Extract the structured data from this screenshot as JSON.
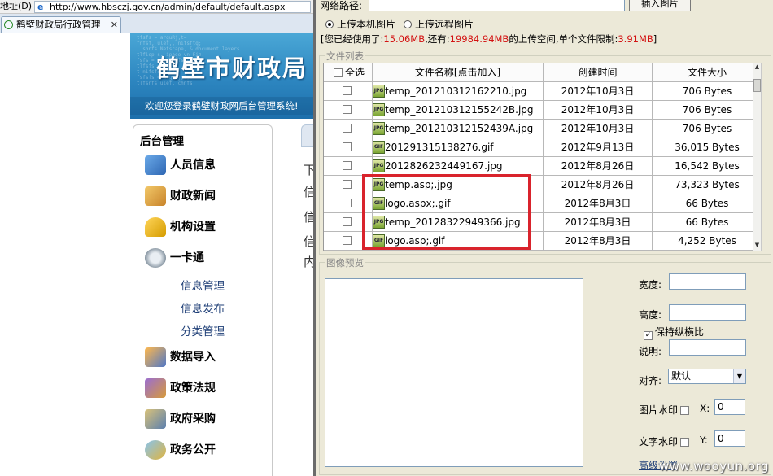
{
  "browser": {
    "address_label": "地址(D)",
    "url": "http://www.hbsczj.gov.cn/admin/default/default.aspx",
    "tab_title": "鹤壁财政局行政管理"
  },
  "banner": {
    "title": "鹤壁市财政局",
    "welcome": "欢迎您登录鹤壁财政网后台管理系统!"
  },
  "sidebar": {
    "title": "后台管理",
    "items": [
      {
        "label": "人员信息",
        "icon": "person-icon"
      },
      {
        "label": "财政新闻",
        "icon": "news-scroll-icon"
      },
      {
        "label": "机构设置",
        "icon": "lock-icon"
      },
      {
        "label": "一卡通",
        "icon": "help-headset-icon"
      },
      {
        "label": "数据导入",
        "icon": "import-icon"
      },
      {
        "label": "政策法规",
        "icon": "law-book-icon"
      },
      {
        "label": "政府采购",
        "icon": "purchase-icon"
      },
      {
        "label": "政务公开",
        "icon": "public-affairs-icon"
      }
    ],
    "subitems": [
      "信息管理",
      "信息发布",
      "分类管理"
    ]
  },
  "content": {
    "chars": [
      "下",
      "信",
      "信",
      "信",
      "内"
    ]
  },
  "dialog": {
    "net_path_label": "网络路径:",
    "insert_button": "插入图片",
    "radio_local": "上传本机图片",
    "radio_remote": "上传远程图片",
    "usage": {
      "prefix": "[您已经使用了:",
      "used": "15.06MB",
      "mid": ",还有:",
      "remaining": "19984.94MB",
      "mid2": "的上传空间,单个文件限制:",
      "limit": "3.91MB",
      "suffix": "]"
    },
    "file_list_legend": "文件列表",
    "table": {
      "headers": [
        "全选",
        "文件名称[点击加入]",
        "创建时间",
        "文件大小"
      ],
      "rows": [
        {
          "name": "temp_201210312162210.jpg",
          "date": "2012年10月3日",
          "size": "706 Bytes",
          "icon": "JPG"
        },
        {
          "name": "temp_201210312155242B.jpg",
          "date": "2012年10月3日",
          "size": "706 Bytes",
          "icon": "JPG"
        },
        {
          "name": "temp_201210312152439A.jpg",
          "date": "2012年10月3日",
          "size": "706 Bytes",
          "icon": "JPG"
        },
        {
          "name": "201291315138276.gif",
          "date": "2012年9月13日",
          "size": "36,015 Bytes",
          "icon": "GIF"
        },
        {
          "name": "2012826232449167.jpg",
          "date": "2012年8月26日",
          "size": "16,542 Bytes",
          "icon": "JPG"
        },
        {
          "name": "temp.asp;.jpg",
          "date": "2012年8月26日",
          "size": "73,323 Bytes",
          "icon": "JPG"
        },
        {
          "name": "logo.aspx;.gif",
          "date": "2012年8月3日",
          "size": "66 Bytes",
          "icon": "GIF"
        },
        {
          "name": "temp_20128322949366.jpg",
          "date": "2012年8月3日",
          "size": "66 Bytes",
          "icon": "JPG"
        },
        {
          "name": "logo.asp;.gif",
          "date": "2012年8月3日",
          "size": "4,252 Bytes",
          "icon": "GIF"
        }
      ]
    },
    "preview_legend": "图像预览",
    "width_label": "宽度:",
    "height_label": "高度:",
    "keep_ratio_label": "保持纵横比",
    "desc_label": "说明:",
    "align_label": "对齐:",
    "align_value": "默认",
    "image_watermark_label": "图片水印",
    "text_watermark_label": "文字水印",
    "x_label": "X:",
    "y_label": "Y:",
    "x_value": "0",
    "y_value": "0",
    "advanced_link": "高级设置"
  },
  "watermark": "www.wooyun.org"
}
